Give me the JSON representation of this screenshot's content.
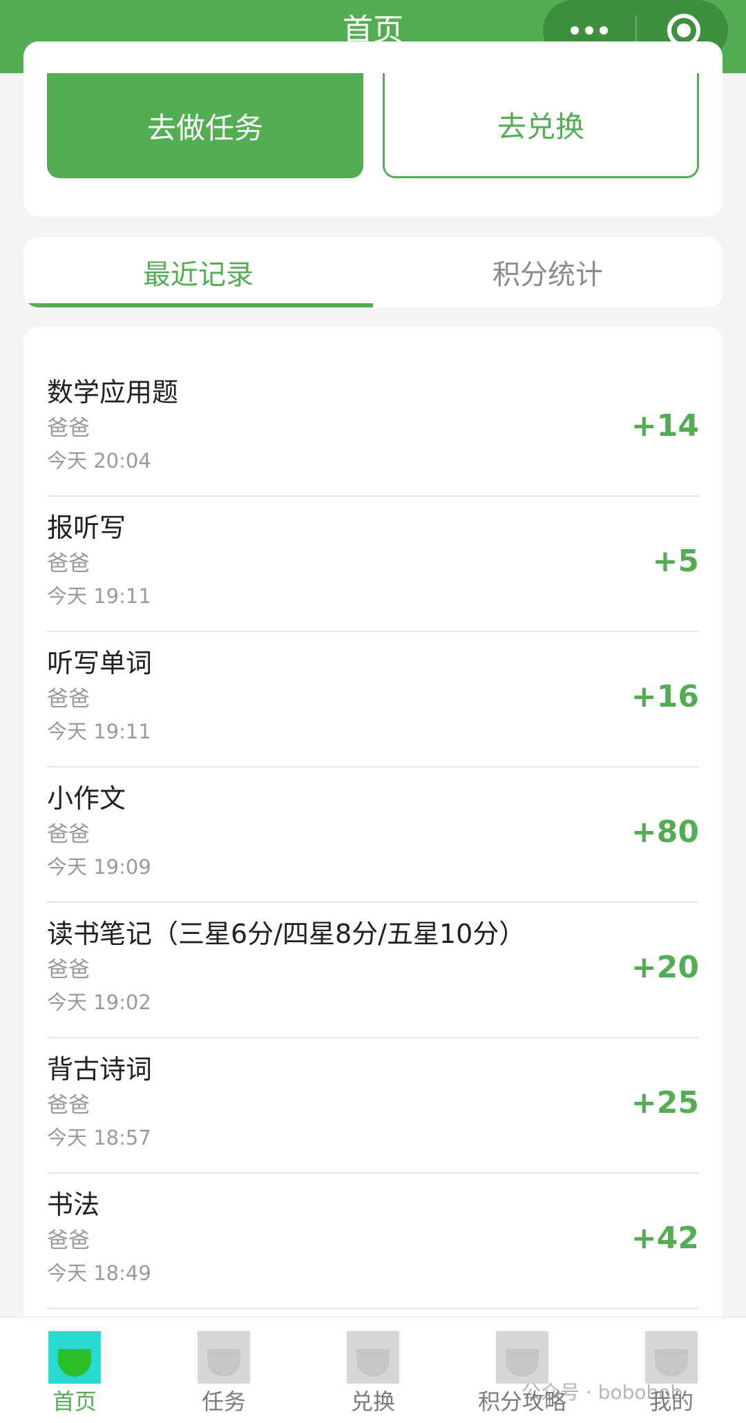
{
  "header": {
    "title": "首页",
    "more_icon": "more-dots-icon",
    "target_icon": "target-icon"
  },
  "actions": {
    "do_tasks": "去做任务",
    "redeem": "去兑换"
  },
  "tabs": [
    {
      "label": "最近记录",
      "active": true
    },
    {
      "label": "积分统计",
      "active": false
    }
  ],
  "records": [
    {
      "title": "数学应用题",
      "by": "爸爸",
      "time": "今天 20:04",
      "points": "+14"
    },
    {
      "title": "报听写",
      "by": "爸爸",
      "time": "今天 19:11",
      "points": "+5"
    },
    {
      "title": "听写单词",
      "by": "爸爸",
      "time": "今天 19:11",
      "points": "+16"
    },
    {
      "title": "小作文",
      "by": "爸爸",
      "time": "今天 19:09",
      "points": "+80"
    },
    {
      "title": "读书笔记（三星6分/四星8分/五星10分）",
      "by": "爸爸",
      "time": "今天 19:02",
      "points": "+20"
    },
    {
      "title": "背古诗词",
      "by": "爸爸",
      "time": "今天 18:57",
      "points": "+25"
    },
    {
      "title": "书法",
      "by": "爸爸",
      "time": "今天 18:49",
      "points": "+42"
    }
  ],
  "tabbar": [
    {
      "label": "首页",
      "active": true
    },
    {
      "label": "任务",
      "active": false
    },
    {
      "label": "兑换",
      "active": false
    },
    {
      "label": "积分攻略",
      "active": false
    },
    {
      "label": "我的",
      "active": false
    }
  ],
  "watermark": "公众号 · bobobob",
  "colors": {
    "primary": "#53ad53",
    "capsule": "#3e8f3e",
    "muted_text": "#9a9a9a",
    "background": "#f4f4f5"
  }
}
